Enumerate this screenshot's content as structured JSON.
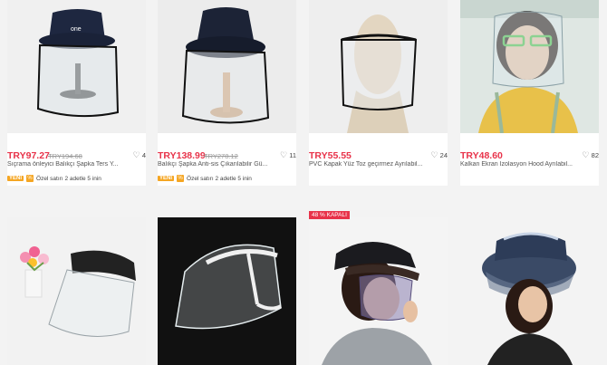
{
  "products": [
    {
      "price": "TRY97.27",
      "old_price": "TRY194.68",
      "likes": "4",
      "title": "Sıçrama önleyici Balıkçı Şapka Ters Y...",
      "badge_new": "YENİ",
      "promo": "Özel satırı 2 adetle 5 inin"
    },
    {
      "price": "TRY138.99",
      "old_price": "TRY278.12",
      "likes": "11",
      "title": "Balıkçı Şapka Anti-sis Çıkarılabilir Gü...",
      "badge_new": "YENİ",
      "promo": "Özel satırı 2 adetle 5 inin"
    },
    {
      "price": "TRY55.55",
      "likes": "24",
      "title": "PVC Kapak Yüz Toz geçirmez Ayrılabil..."
    },
    {
      "price": "TRY48.60",
      "likes": "82",
      "title": "Kalkan Ekran İzolasyon Hood Ayrılabil..."
    },
    {},
    {},
    {
      "discount_badge": "48 % KAPALI"
    },
    {}
  ],
  "icons": {
    "like": "heart-icon",
    "promo": "tag-icon"
  },
  "colors": {
    "price": "#e8334a",
    "badge": "#f5a623",
    "background": "#f3f3f3"
  }
}
